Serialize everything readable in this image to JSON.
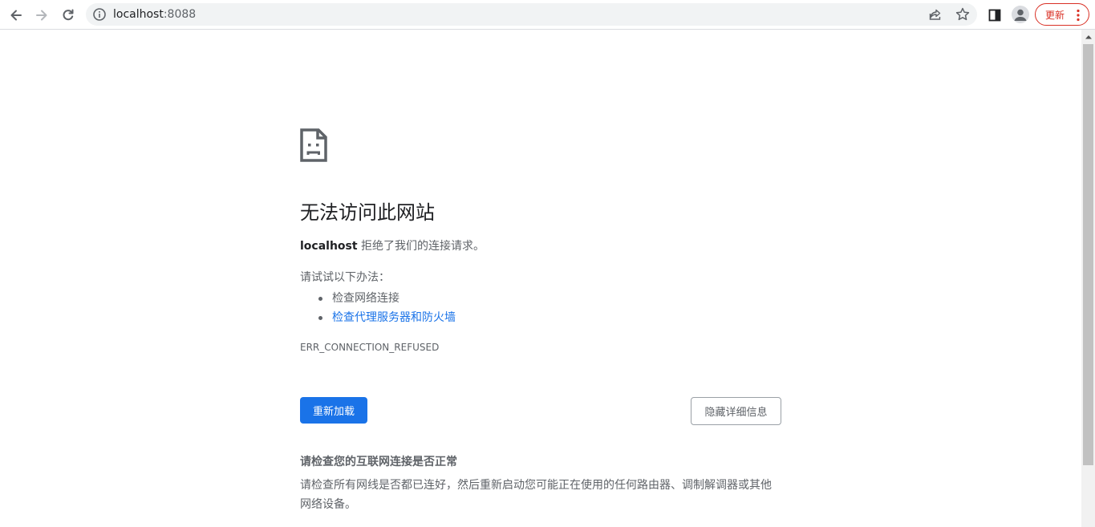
{
  "browser": {
    "url_host": "localhost",
    "url_port": ":8088",
    "update_label": "更新"
  },
  "error": {
    "title": "无法访问此网站",
    "host": "localhost",
    "description": " 拒绝了我们的连接请求。",
    "try_label": "请试试以下办法：",
    "suggestions": [
      {
        "label": "检查网络连接"
      },
      {
        "label": "检查代理服务器和防火墙"
      }
    ],
    "code": "ERR_CONNECTION_REFUSED",
    "reload_label": "重新加载",
    "details_label": "隐藏详细信息",
    "detail_heading": "请检查您的互联网连接是否正常",
    "detail_body": "请检查所有网线是否都已连好，然后重新启动您可能正在使用的任何路由器、调制解调器或其他网络设备。"
  },
  "colors": {
    "primary_button": "#1a73e8",
    "link": "#1a73e8",
    "update_accent": "#d93025",
    "muted_text": "#5f6368"
  }
}
